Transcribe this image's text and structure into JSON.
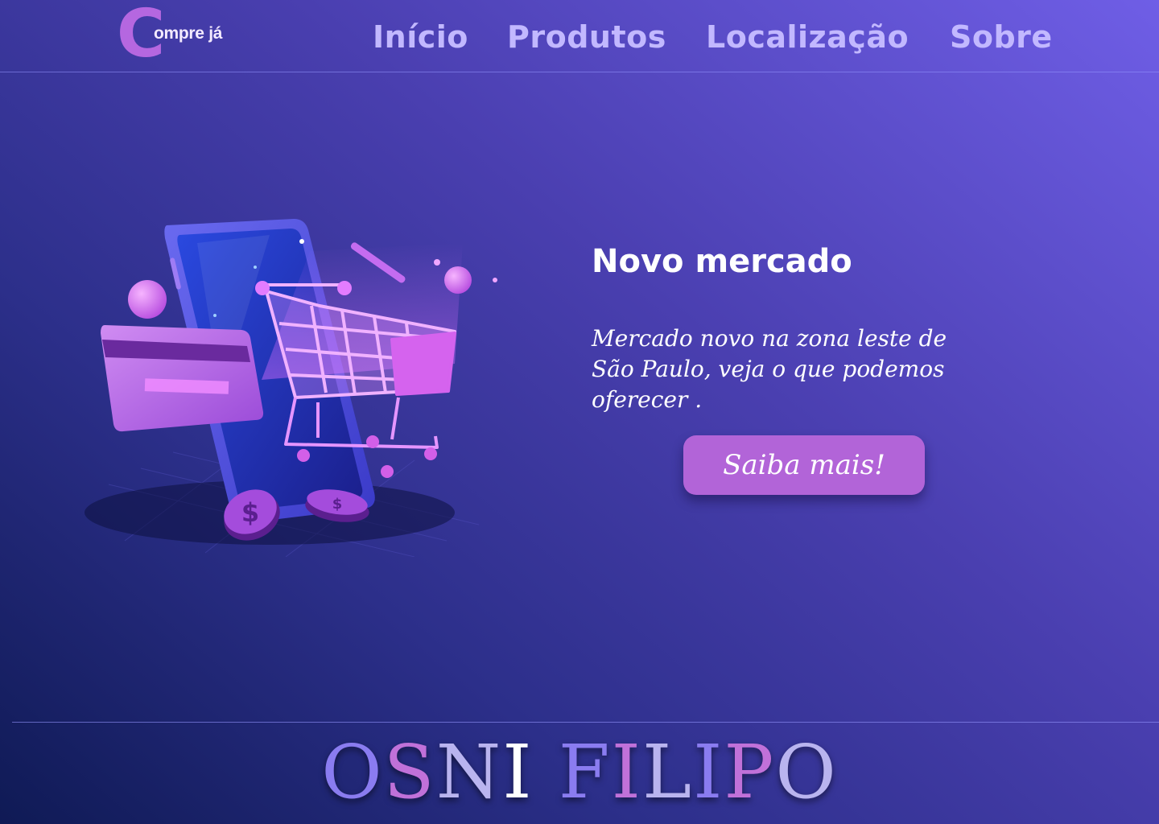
{
  "header": {
    "logo": {
      "mark": "C",
      "text": "ompre já"
    },
    "nav": [
      {
        "label": "Início"
      },
      {
        "label": "Produtos"
      },
      {
        "label": "Localização"
      },
      {
        "label": "Sobre"
      }
    ]
  },
  "hero": {
    "title": "Novo mercado",
    "description": "Mercado novo na zona leste de São Paulo, veja o que podemos oferecer .",
    "button_label": "Saiba mais!",
    "illustration": {
      "icons": [
        "smartphone-icon",
        "shopping-cart-icon",
        "credit-card-icon",
        "coin-icon"
      ],
      "coin_symbol": "$"
    }
  },
  "footer": {
    "signature": "OSNI FILIPO",
    "signature_colors": [
      "#8a7cf0",
      "#c071d9",
      "#b9b4ef",
      "#ffffff",
      "#8a7cf0",
      "#c071d9",
      "#b9b4ef",
      "#8a7cf0",
      "#c071d9",
      "#b9b4ef"
    ]
  },
  "colors": {
    "accent": "#b264d8",
    "nav": "#c2b8ff",
    "logo": "#b567e0"
  }
}
